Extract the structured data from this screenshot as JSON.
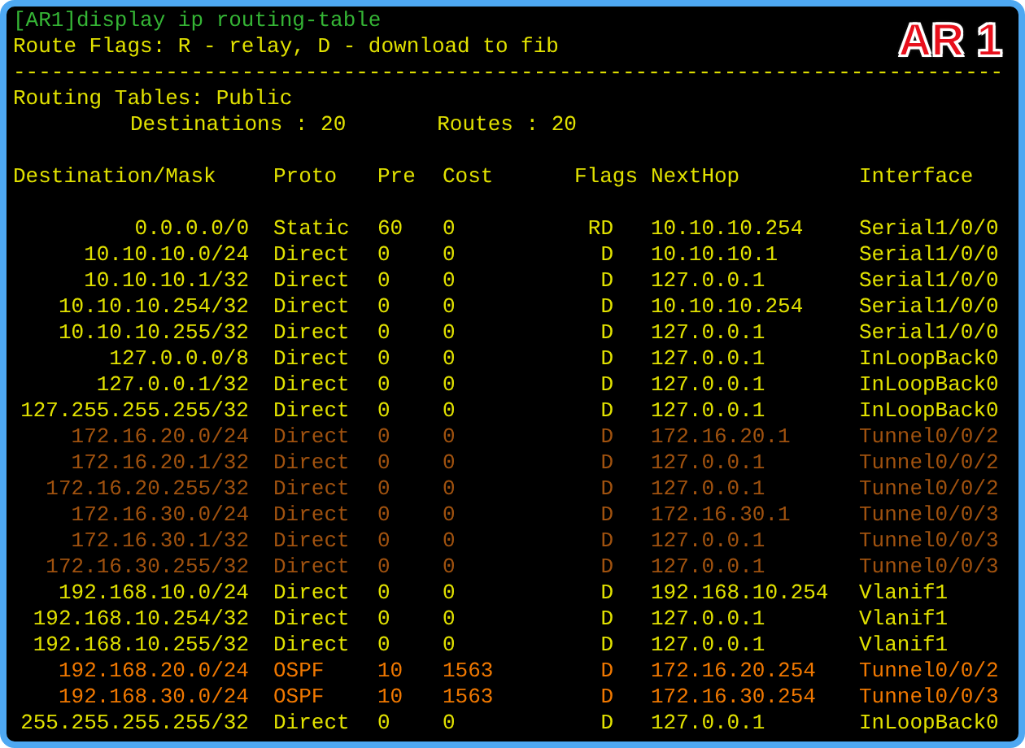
{
  "badge": "AR 1",
  "command": "[AR1]display ip routing-table",
  "flags_legend": "Route Flags: R - relay, D - download to fib",
  "separator": "------------------------------------------------------------------------------",
  "table_name": "Routing Tables: Public",
  "summary": {
    "destinations": "Destinations : 20",
    "routes": "Routes : 20"
  },
  "columns": [
    "Destination/Mask",
    "Proto",
    "Pre",
    "Cost",
    "Flags",
    "NextHop",
    "Interface"
  ],
  "rows": [
    {
      "cells": [
        "0.0.0.0/0",
        "Static",
        "60",
        "0",
        "RD",
        "10.10.10.254",
        "Serial1/0/0"
      ],
      "color": "#e1e100"
    },
    {
      "cells": [
        "10.10.10.0/24",
        "Direct",
        "0",
        "0",
        "D",
        "10.10.10.1",
        "Serial1/0/0"
      ],
      "color": "#e1e100"
    },
    {
      "cells": [
        "10.10.10.1/32",
        "Direct",
        "0",
        "0",
        "D",
        "127.0.0.1",
        "Serial1/0/0"
      ],
      "color": "#e1e100"
    },
    {
      "cells": [
        "10.10.10.254/32",
        "Direct",
        "0",
        "0",
        "D",
        "10.10.10.254",
        "Serial1/0/0"
      ],
      "color": "#e1e100"
    },
    {
      "cells": [
        "10.10.10.255/32",
        "Direct",
        "0",
        "0",
        "D",
        "127.0.0.1",
        "Serial1/0/0"
      ],
      "color": "#e1e100"
    },
    {
      "cells": [
        "127.0.0.0/8",
        "Direct",
        "0",
        "0",
        "D",
        "127.0.0.1",
        "InLoopBack0"
      ],
      "color": "#e1e100"
    },
    {
      "cells": [
        "127.0.0.1/32",
        "Direct",
        "0",
        "0",
        "D",
        "127.0.0.1",
        "InLoopBack0"
      ],
      "color": "#e1e100"
    },
    {
      "cells": [
        "127.255.255.255/32",
        "Direct",
        "0",
        "0",
        "D",
        "127.0.0.1",
        "InLoopBack0"
      ],
      "color": "#e1e100"
    },
    {
      "cells": [
        "172.16.20.0/24",
        "Direct",
        "0",
        "0",
        "D",
        "172.16.20.1",
        "Tunnel0/0/2"
      ],
      "color": "#a0520f"
    },
    {
      "cells": [
        "172.16.20.1/32",
        "Direct",
        "0",
        "0",
        "D",
        "127.0.0.1",
        "Tunnel0/0/2"
      ],
      "color": "#a0520f"
    },
    {
      "cells": [
        "172.16.20.255/32",
        "Direct",
        "0",
        "0",
        "D",
        "127.0.0.1",
        "Tunnel0/0/2"
      ],
      "color": "#a0520f"
    },
    {
      "cells": [
        "172.16.30.0/24",
        "Direct",
        "0",
        "0",
        "D",
        "172.16.30.1",
        "Tunnel0/0/3"
      ],
      "color": "#a0520f"
    },
    {
      "cells": [
        "172.16.30.1/32",
        "Direct",
        "0",
        "0",
        "D",
        "127.0.0.1",
        "Tunnel0/0/3"
      ],
      "color": "#a0520f"
    },
    {
      "cells": [
        "172.16.30.255/32",
        "Direct",
        "0",
        "0",
        "D",
        "127.0.0.1",
        "Tunnel0/0/3"
      ],
      "color": "#a0520f"
    },
    {
      "cells": [
        "192.168.10.0/24",
        "Direct",
        "0",
        "0",
        "D",
        "192.168.10.254",
        "Vlanif1"
      ],
      "color": "#e1e100"
    },
    {
      "cells": [
        "192.168.10.254/32",
        "Direct",
        "0",
        "0",
        "D",
        "127.0.0.1",
        "Vlanif1"
      ],
      "color": "#e1e100"
    },
    {
      "cells": [
        "192.168.10.255/32",
        "Direct",
        "0",
        "0",
        "D",
        "127.0.0.1",
        "Vlanif1"
      ],
      "color": "#e1e100"
    },
    {
      "cells": [
        "192.168.20.0/24",
        "OSPF",
        "10",
        "1563",
        "D",
        "172.16.20.254",
        "Tunnel0/0/2"
      ],
      "color": "#f07800"
    },
    {
      "cells": [
        "192.168.30.0/24",
        "OSPF",
        "10",
        "1563",
        "D",
        "172.16.30.254",
        "Tunnel0/0/3"
      ],
      "color": "#f07800"
    },
    {
      "cells": [
        "255.255.255.255/32",
        "Direct",
        "0",
        "0",
        "D",
        "127.0.0.1",
        "InLoopBack0"
      ],
      "color": "#e1e100"
    }
  ]
}
